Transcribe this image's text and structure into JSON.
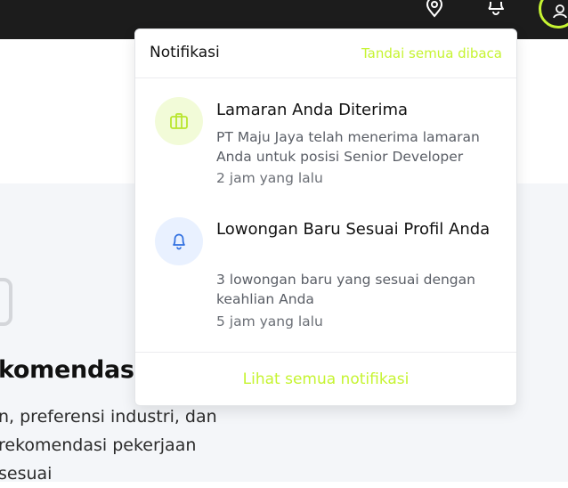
{
  "topbar": {
    "icons": [
      "location-pin-icon",
      "bell-icon",
      "user-icon"
    ],
    "accent": "#c6f432",
    "background": "#1c1c1c"
  },
  "background_section": {
    "title": "komendasi",
    "description_lines": [
      "n, preferensi industri, dan",
      "rekomendasi pekerjaan",
      "sesuai"
    ]
  },
  "notifications_panel": {
    "title": "Notifikasi",
    "mark_all_label": "Tandai semua dibaca",
    "items": [
      {
        "icon": "briefcase-icon",
        "icon_bg": "#f2fbd8",
        "icon_color": "#b8e62e",
        "title": "Lamaran Anda Diterima",
        "body": "PT Maju Jaya telah menerima lamaran Anda untuk posisi Senior Developer",
        "time": "2 jam yang lalu"
      },
      {
        "icon": "bell-icon",
        "icon_bg": "#e9f1ff",
        "icon_color": "#2f6fe0",
        "title": "Lowongan Baru Sesuai Profil Anda",
        "body": "3 lowongan baru yang sesuai dengan keahlian Anda",
        "time": "5 jam yang lalu"
      }
    ],
    "view_all_label": "Lihat semua notifikasi"
  }
}
